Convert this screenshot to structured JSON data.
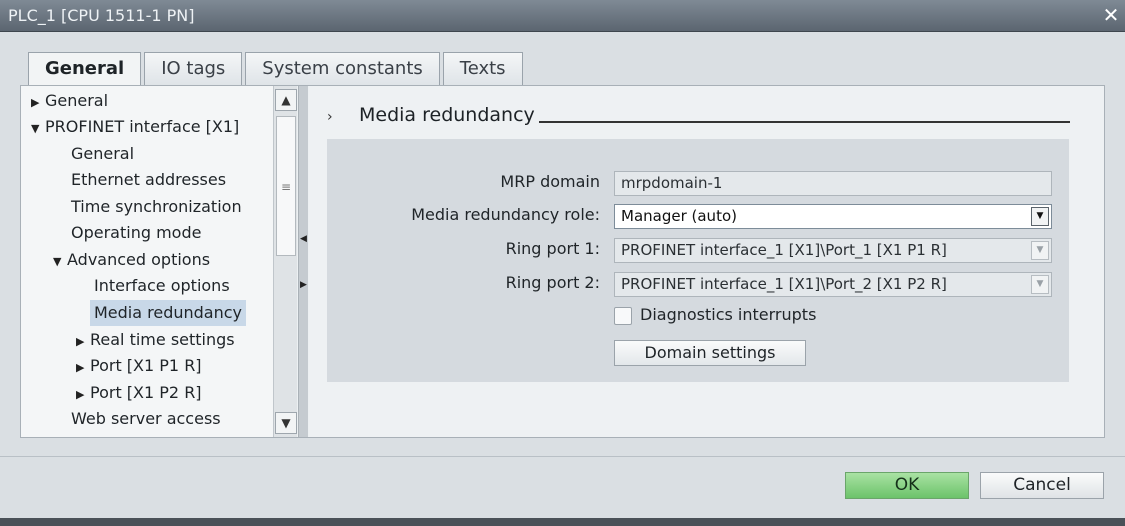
{
  "window": {
    "title": "PLC_1 [CPU 1511-1 PN]",
    "close_glyph": "✕"
  },
  "tabs": [
    {
      "label": "General",
      "active": true
    },
    {
      "label": "IO tags",
      "active": false
    },
    {
      "label": "System constants",
      "active": false
    },
    {
      "label": "Texts",
      "active": false
    }
  ],
  "tree": {
    "items": [
      {
        "label": "General",
        "caret": "▶"
      },
      {
        "label": "PROFINET interface [X1]",
        "caret": "▼"
      },
      {
        "label": "General",
        "caret": ""
      },
      {
        "label": "Ethernet addresses",
        "caret": ""
      },
      {
        "label": "Time synchronization",
        "caret": ""
      },
      {
        "label": "Operating mode",
        "caret": ""
      },
      {
        "label": "Advanced options",
        "caret": "▼"
      },
      {
        "label": "Interface options",
        "caret": ""
      },
      {
        "label": "Media redundancy",
        "caret": "",
        "selected": true
      },
      {
        "label": "Real time settings",
        "caret": "▶"
      },
      {
        "label": "Port [X1 P1 R]",
        "caret": "▶"
      },
      {
        "label": "Port [X1 P2 R]",
        "caret": "▶"
      },
      {
        "label": "Web server access",
        "caret": ""
      }
    ]
  },
  "section": {
    "arrow": "›",
    "title": "Media redundancy",
    "mrp_domain_label": "MRP domain",
    "mrp_domain_value": "mrpdomain-1",
    "role_label": "Media redundancy role:",
    "role_value": "Manager (auto)",
    "ring_port1_label": "Ring port 1:",
    "ring_port1_value": "PROFINET interface_1 [X1]\\Port_1 [X1 P1 R]",
    "ring_port2_label": "Ring port 2:",
    "ring_port2_value": "PROFINET interface_1 [X1]\\Port_2 [X1 P2 R]",
    "diagnostics_label": "Diagnostics interrupts",
    "diagnostics_checked": false,
    "domain_settings_label": "Domain settings"
  },
  "footer": {
    "ok_label": "OK",
    "cancel_label": "Cancel"
  }
}
